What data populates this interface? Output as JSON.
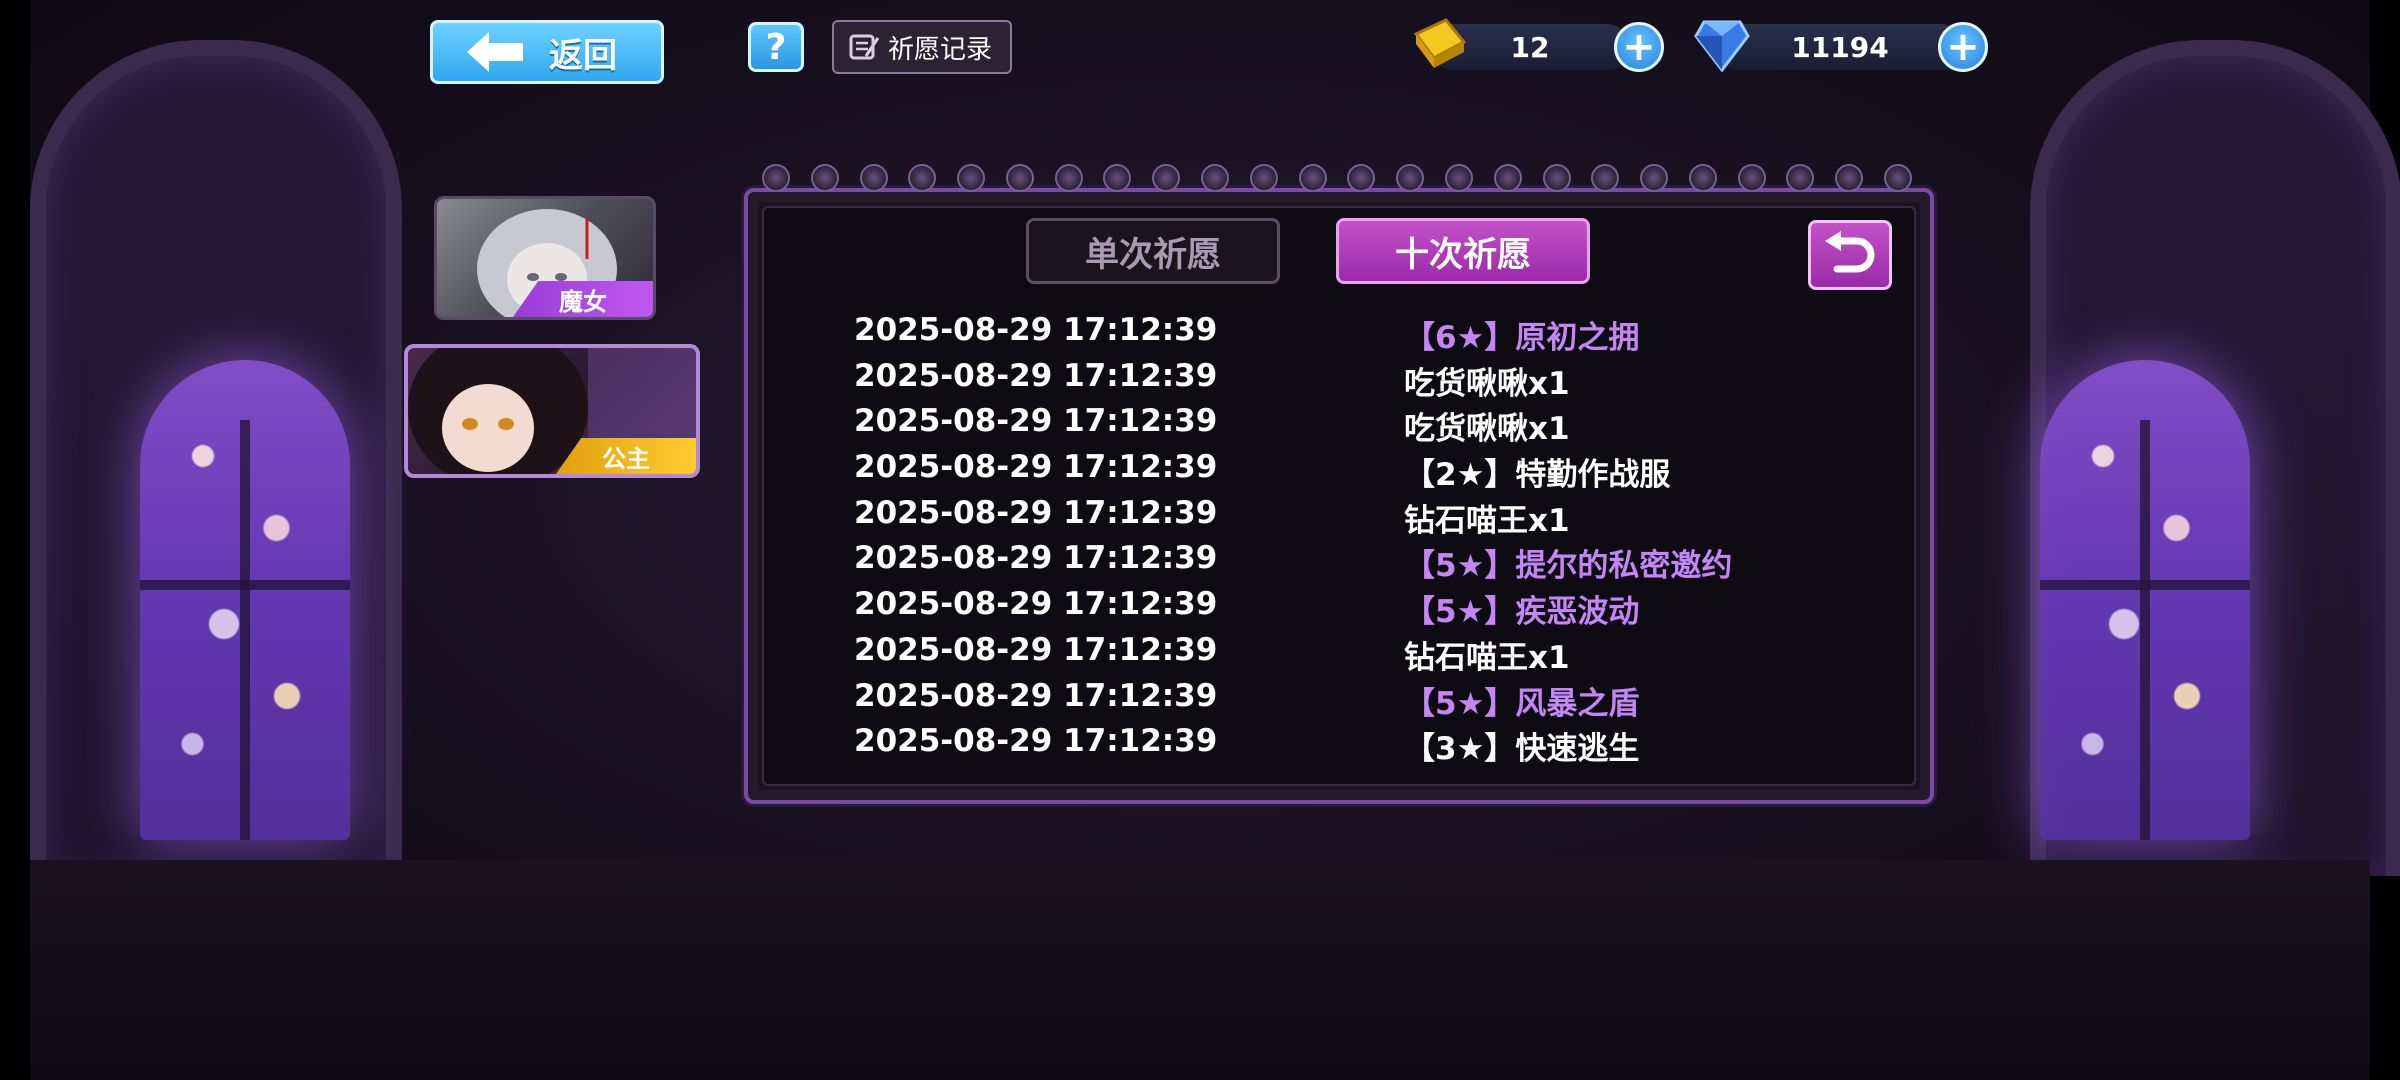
{
  "top_bar": {
    "back_label": "返回",
    "help_label": "?",
    "record_label": "祈愿记录",
    "gold_amount": "12",
    "diamond_amount": "11194",
    "plus_label": "+"
  },
  "characters": [
    {
      "tag": "魔女",
      "selected": false
    },
    {
      "tag": "公主",
      "selected": true
    }
  ],
  "tabs": {
    "single_label": "单次祈愿",
    "ten_label": "十次祈愿",
    "active": "ten"
  },
  "records": [
    {
      "time": "2025-08-29 17:12:39",
      "item": "【6★】原初之拥",
      "color": "#c486f4"
    },
    {
      "time": "2025-08-29 17:12:39",
      "item": "吃货啾啾x1",
      "color": "#ffffff"
    },
    {
      "time": "2025-08-29 17:12:39",
      "item": "吃货啾啾x1",
      "color": "#ffffff"
    },
    {
      "time": "2025-08-29 17:12:39",
      "item": "【2★】特勤作战服",
      "color": "#ffffff"
    },
    {
      "time": "2025-08-29 17:12:39",
      "item": "钻石喵王x1",
      "color": "#ffffff"
    },
    {
      "time": "2025-08-29 17:12:39",
      "item": "【5★】提尔的私密邀约",
      "color": "#c486f4"
    },
    {
      "time": "2025-08-29 17:12:39",
      "item": "【5★】疾恶波动",
      "color": "#c486f4"
    },
    {
      "time": "2025-08-29 17:12:39",
      "item": "钻石喵王x1",
      "color": "#ffffff"
    },
    {
      "time": "2025-08-29 17:12:39",
      "item": "【5★】风暴之盾",
      "color": "#c486f4"
    },
    {
      "time": "2025-08-29 17:12:39",
      "item": "【3★】快速逃生",
      "color": "#ffffff"
    }
  ],
  "colors": {
    "accent_purple": "#9a2aa8",
    "highlight_item": "#c486f4",
    "button_blue": "#2fa8f0"
  }
}
